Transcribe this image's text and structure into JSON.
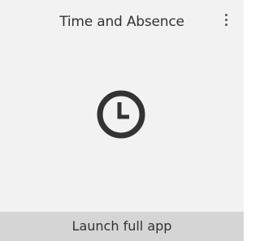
{
  "card": {
    "title": "Time and Absence",
    "menu_icon": "more-vertical-icon",
    "main_icon": "clock-icon",
    "footer_label": "Launch full app"
  },
  "colors": {
    "card_background": "#f2f2f2",
    "footer_background": "#d5d5d5",
    "text": "#333333",
    "icon": "#333333"
  }
}
